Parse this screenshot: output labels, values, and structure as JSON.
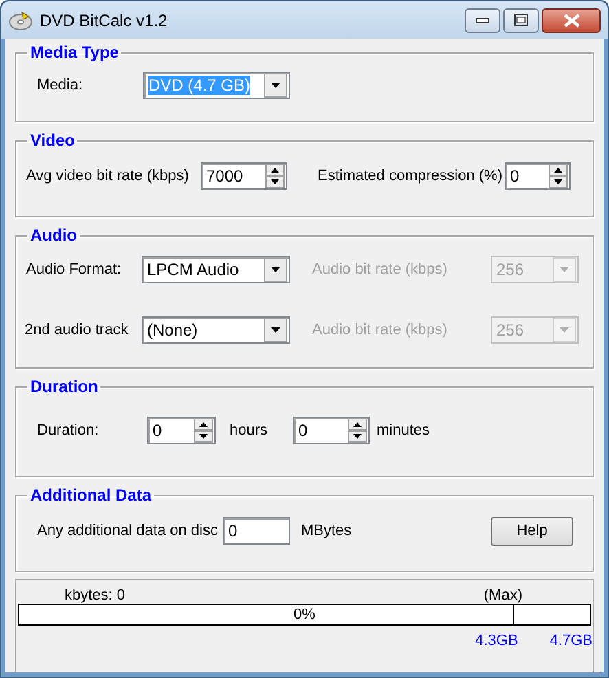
{
  "window": {
    "title": "DVD BitCalc v1.2"
  },
  "media_type": {
    "title": "Media Type",
    "label": "Media:",
    "value": "DVD (4.7 GB)",
    "highlighted": true
  },
  "video": {
    "title": "Video",
    "bitrate": {
      "label": "Avg video bit rate (kbps)",
      "value": "7000"
    },
    "compression": {
      "label": "Estimated compression (%)",
      "value": "0"
    }
  },
  "audio": {
    "title": "Audio",
    "rows": [
      {
        "label": "Audio Format:",
        "value": "LPCM Audio",
        "bitrate_label": "Audio bit rate (kbps)",
        "bitrate_value": "256",
        "bitrate_disabled": true
      },
      {
        "label": "2nd audio track",
        "value": "(None)",
        "bitrate_label": "Audio bit rate (kbps)",
        "bitrate_value": "256",
        "bitrate_disabled": true
      }
    ]
  },
  "duration": {
    "title": "Duration",
    "label": "Duration:",
    "hours": "0",
    "hours_unit": "hours",
    "minutes": "0",
    "minutes_unit": "minutes"
  },
  "additional_data": {
    "title": "Additional Data",
    "label": "Any additional data on disc",
    "value": "0",
    "unit": "MBytes",
    "button": "Help"
  },
  "status": {
    "kbytes": "kbytes: 0",
    "max": "(Max)",
    "progress": {
      "level": 0,
      "text": "0%"
    },
    "marks": [
      "4.3GB",
      "4.7GB"
    ]
  }
}
